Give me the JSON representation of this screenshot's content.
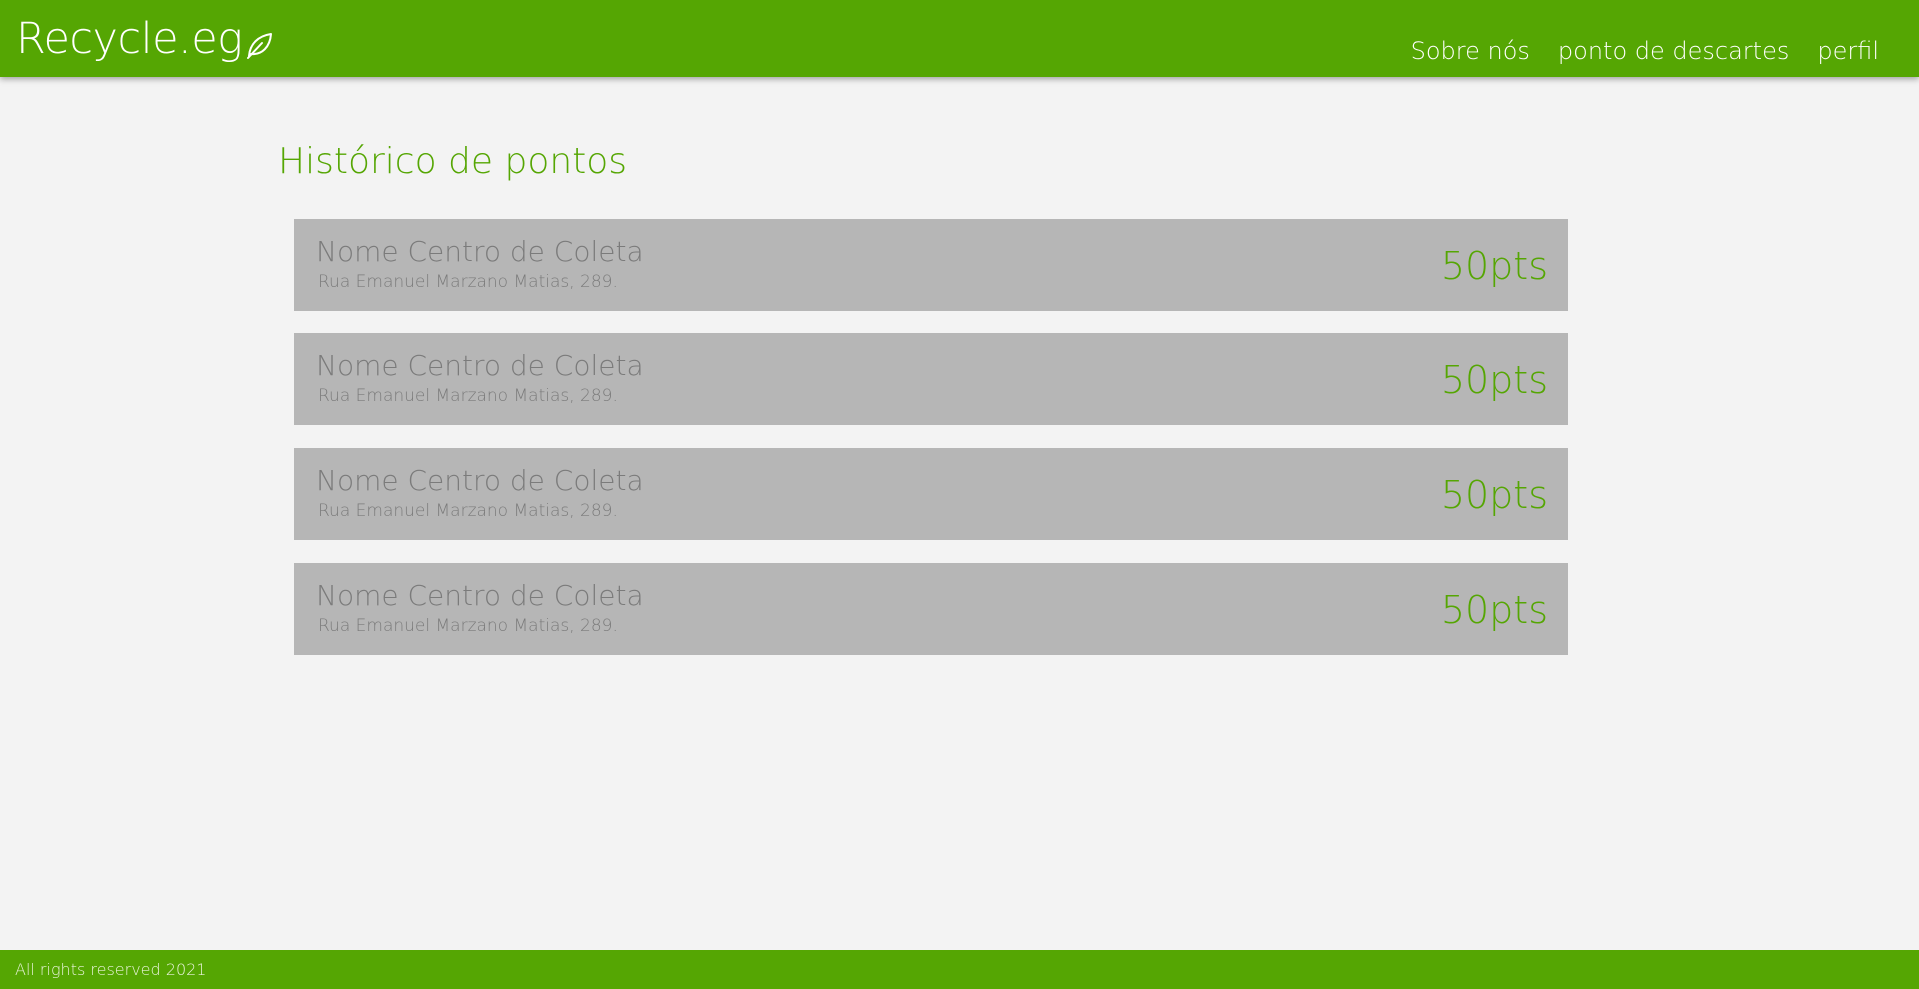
{
  "header": {
    "brand": "Recycle.eg",
    "brand_icon": "leaf-icon",
    "nav": [
      {
        "label": "Sobre nós"
      },
      {
        "label": "ponto de descartes"
      },
      {
        "label": "perfil"
      }
    ]
  },
  "main": {
    "title": "Histórico de pontos",
    "entries": [
      {
        "name": "Nome Centro de Coleta",
        "address": "Rua Emanuel Marzano Matias, 289.",
        "points": "50pts"
      },
      {
        "name": "Nome Centro de Coleta",
        "address": "Rua Emanuel Marzano Matias, 289.",
        "points": "50pts"
      },
      {
        "name": "Nome Centro de Coleta",
        "address": "Rua Emanuel Marzano Matias, 289.",
        "points": "50pts"
      },
      {
        "name": "Nome Centro de Coleta",
        "address": "Rua Emanuel Marzano Matias, 289.",
        "points": "50pts"
      }
    ]
  },
  "footer": {
    "text": "All rights reserved 2021"
  },
  "colors": {
    "brand_green": "#55a603",
    "page_background": "#f3f3f3",
    "card_background": "#b6b6b6",
    "card_text": "#7b7b7b"
  }
}
